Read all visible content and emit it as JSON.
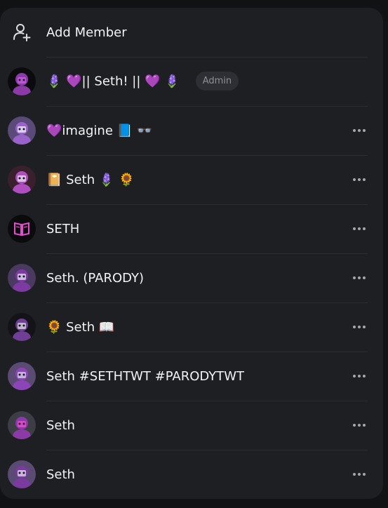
{
  "add_member": {
    "label": "Add Member",
    "icon": "add-user-icon"
  },
  "members": [
    {
      "name": "🪻 💜|| Seth! || 💜 🪻",
      "badge": "Admin",
      "show_more": false
    },
    {
      "name": "💜imagine 📘 👓",
      "badge": "",
      "show_more": true
    },
    {
      "name": "📔 Seth 🪻 🌻",
      "badge": "",
      "show_more": true
    },
    {
      "name": "SETH",
      "badge": "",
      "show_more": true
    },
    {
      "name": "Seth. (PARODY)",
      "badge": "",
      "show_more": true
    },
    {
      "name": "🌻 Seth 📖",
      "badge": "",
      "show_more": true
    },
    {
      "name": "Seth #SETHTWT #PARODYTWT",
      "badge": "",
      "show_more": true
    },
    {
      "name": "Seth",
      "badge": "",
      "show_more": true
    },
    {
      "name": "Seth",
      "badge": "",
      "show_more": true
    }
  ],
  "colors": {
    "panel_bg": "#1e1f22",
    "page_bg": "#111214",
    "avatar_purple": "#8b3aa8",
    "avatar_accent": "#e64bd0"
  }
}
